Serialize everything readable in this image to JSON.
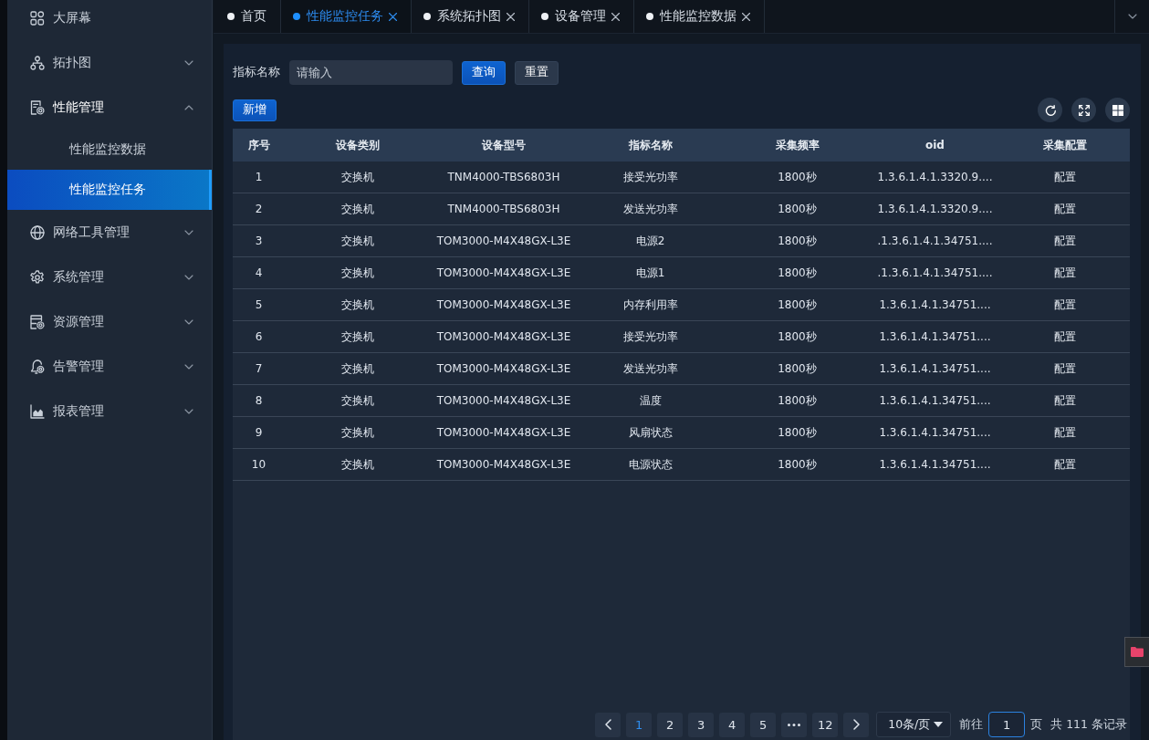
{
  "sidebar": {
    "items": [
      {
        "kind": "link",
        "label": "大屏幕",
        "selected": false
      },
      {
        "kind": "menu",
        "label": "拓扑图",
        "selected": false,
        "expanded": false
      },
      {
        "kind": "menu",
        "label": "性能管理",
        "selected": false,
        "expanded": true,
        "children": [
          {
            "label": "性能监控数据",
            "selected": false
          },
          {
            "label": "性能监控任务",
            "selected": true
          }
        ]
      },
      {
        "kind": "menu",
        "label": "网络工具管理",
        "selected": false,
        "expanded": false
      },
      {
        "kind": "menu",
        "label": "系统管理",
        "selected": false,
        "expanded": false
      },
      {
        "kind": "menu",
        "label": "资源管理",
        "selected": false,
        "expanded": false
      },
      {
        "kind": "menu",
        "label": "告警管理",
        "selected": false,
        "expanded": false
      },
      {
        "kind": "menu",
        "label": "报表管理",
        "selected": false,
        "expanded": false
      }
    ]
  },
  "tabs": [
    {
      "label": "首页",
      "selected": false,
      "closable": false
    },
    {
      "label": "性能监控任务",
      "selected": true,
      "closable": true
    },
    {
      "label": "系统拓扑图",
      "selected": false,
      "closable": true
    },
    {
      "label": "设备管理",
      "selected": false,
      "closable": true
    },
    {
      "label": "性能监控数据",
      "selected": false,
      "closable": true
    }
  ],
  "filter": {
    "label": "指标名称",
    "placeholder": "请输入",
    "buttons": [
      {
        "label": "查询",
        "kind": "primary"
      },
      {
        "label": "重置",
        "kind": "default"
      }
    ]
  },
  "toolbar": {
    "add_button": "新增"
  },
  "table": {
    "columns": [
      {
        "label": "序号",
        "kind": "text"
      },
      {
        "label": "设备类别",
        "kind": "text"
      },
      {
        "label": "设备型号",
        "kind": "text"
      },
      {
        "label": "指标名称",
        "kind": "text"
      },
      {
        "label": "采集频率",
        "kind": "text"
      },
      {
        "label": "oid",
        "kind": "text"
      },
      {
        "label": "采集配置",
        "kind": "action"
      }
    ],
    "rows": [
      [
        "1",
        "交换机",
        "TNM4000-TBS6803H",
        "接受光功率",
        "1800秒",
        "1.3.6.1.4.1.3320.9....",
        "配置"
      ],
      [
        "2",
        "交换机",
        "TNM4000-TBS6803H",
        "发送光功率",
        "1800秒",
        "1.3.6.1.4.1.3320.9....",
        "配置"
      ],
      [
        "3",
        "交换机",
        "TOM3000-M4X48GX-L3E",
        "电源2",
        "1800秒",
        ".1.3.6.1.4.1.34751....",
        "配置"
      ],
      [
        "4",
        "交换机",
        "TOM3000-M4X48GX-L3E",
        "电源1",
        "1800秒",
        ".1.3.6.1.4.1.34751....",
        "配置"
      ],
      [
        "5",
        "交换机",
        "TOM3000-M4X48GX-L3E",
        "内存利用率",
        "1800秒",
        "1.3.6.1.4.1.34751....",
        "配置"
      ],
      [
        "6",
        "交换机",
        "TOM3000-M4X48GX-L3E",
        "接受光功率",
        "1800秒",
        "1.3.6.1.4.1.34751....",
        "配置"
      ],
      [
        "7",
        "交换机",
        "TOM3000-M4X48GX-L3E",
        "发送光功率",
        "1800秒",
        "1.3.6.1.4.1.34751....",
        "配置"
      ],
      [
        "8",
        "交换机",
        "TOM3000-M4X48GX-L3E",
        "温度",
        "1800秒",
        "1.3.6.1.4.1.34751....",
        "配置"
      ],
      [
        "9",
        "交换机",
        "TOM3000-M4X48GX-L3E",
        "风扇状态",
        "1800秒",
        "1.3.6.1.4.1.34751....",
        "配置"
      ],
      [
        "10",
        "交换机",
        "TOM3000-M4X48GX-L3E",
        "电源状态",
        "1800秒",
        "1.3.6.1.4.1.34751....",
        "配置"
      ]
    ]
  },
  "pagination": {
    "pages": [
      {
        "kind": "page",
        "label": "1",
        "selected": true
      },
      {
        "kind": "page",
        "label": "2",
        "selected": false
      },
      {
        "kind": "page",
        "label": "3",
        "selected": false
      },
      {
        "kind": "page",
        "label": "4",
        "selected": false
      },
      {
        "kind": "page",
        "label": "5",
        "selected": false
      },
      {
        "kind": "more",
        "selected": false
      },
      {
        "kind": "page",
        "label": "12",
        "selected": false
      }
    ],
    "page_size": "10条/页",
    "goto_label": "前往",
    "goto_value": "1",
    "page_unit": "页",
    "total": "共 111 条记录"
  }
}
